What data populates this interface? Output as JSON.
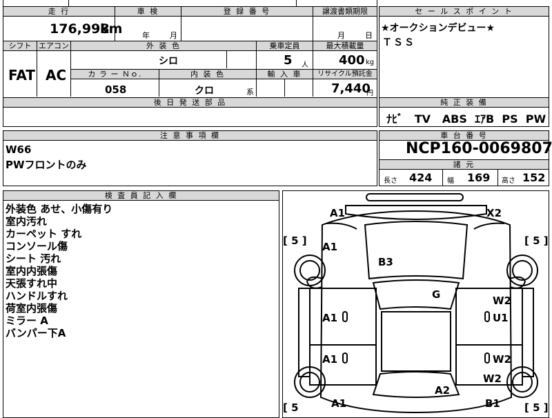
{
  "top": {
    "mileage_header": "走 行",
    "mileage_value": "176,998",
    "mileage_unit": "km",
    "inspection_header": "車 検",
    "year_label": "年",
    "month_label": "月",
    "registration_header": "登 録 番 号",
    "transfer_header": "譲渡書類期限",
    "transfer_month": "月",
    "transfer_day": "日"
  },
  "row2": {
    "shift_header": "シフト",
    "aircon_header": "エアコン",
    "exterior_color_header": "外 装 色",
    "exterior_color_value": "シロ",
    "capacity_header": "乗車定員",
    "capacity_value": "5",
    "capacity_unit": "人",
    "max_load_header": "最大積載量",
    "max_load_value": "400",
    "max_load_unit": "kg",
    "shift_value": "FAT",
    "aircon_value": "AC",
    "color_no_header": "カ ラ ー Ｎｏ.",
    "color_no_value": "058",
    "interior_color_header": "内 装 色",
    "interior_color_value": "クロ",
    "interior_color_suffix": "系",
    "import_header": "輸 入 車",
    "recycle_header": "リサイクル預託金",
    "recycle_value": "7,440",
    "recycle_unit": "円"
  },
  "parts": {
    "header": "後 日 発 送 部 品"
  },
  "sales": {
    "header": "セ ー ル ス ポ イ ン ト",
    "lines": [
      "★オークションデビュー★",
      "ＴＳＳ"
    ]
  },
  "equipment": {
    "header": "純 正 装 備",
    "items": [
      "ﾅﾋﾞ",
      "TV",
      "ABS",
      "ｴｱB",
      "PS",
      "PW"
    ]
  },
  "notes": {
    "header": "注 意 事 項 欄",
    "lines": [
      "W66",
      "PWフロントのみ"
    ]
  },
  "chassis": {
    "header": "車 台 番 号",
    "value": "NCP160-0069807",
    "specs_header": "諸 元",
    "length_label": "長さ",
    "length_value": "424",
    "width_label": "幅",
    "width_value": "169",
    "height_label": "高さ",
    "height_value": "152"
  },
  "inspector": {
    "header": "検 査 員 記 入 欄",
    "lines": [
      "外装色 あせ、小傷有り",
      "室内汚れ",
      "カーペット すれ",
      "コンソール傷",
      "シート 汚れ",
      "室内内張傷",
      "天張すれ中",
      "ハンドルすれ",
      "荷室内張傷",
      "ミラー A",
      "バンパー下A"
    ]
  },
  "diagram": {
    "marks": {
      "front_left": "A1",
      "front_right": "X2",
      "fender_left_front": "A1",
      "hood": "B3",
      "roof": "G",
      "door_right_front_a": "W2",
      "door_right_front_b": "U1",
      "door_left_front": "A1",
      "door_left_rear": "A1",
      "door_right_rear": "W2",
      "quarter_right": "W2",
      "trunk": "A2",
      "rear_left": "A1",
      "rear_right": "B1"
    },
    "tires": {
      "fl": "[ 5 ]",
      "fr": "[ 5 ]",
      "rl": "[ 5",
      "rr": "[ 5 ]"
    }
  }
}
